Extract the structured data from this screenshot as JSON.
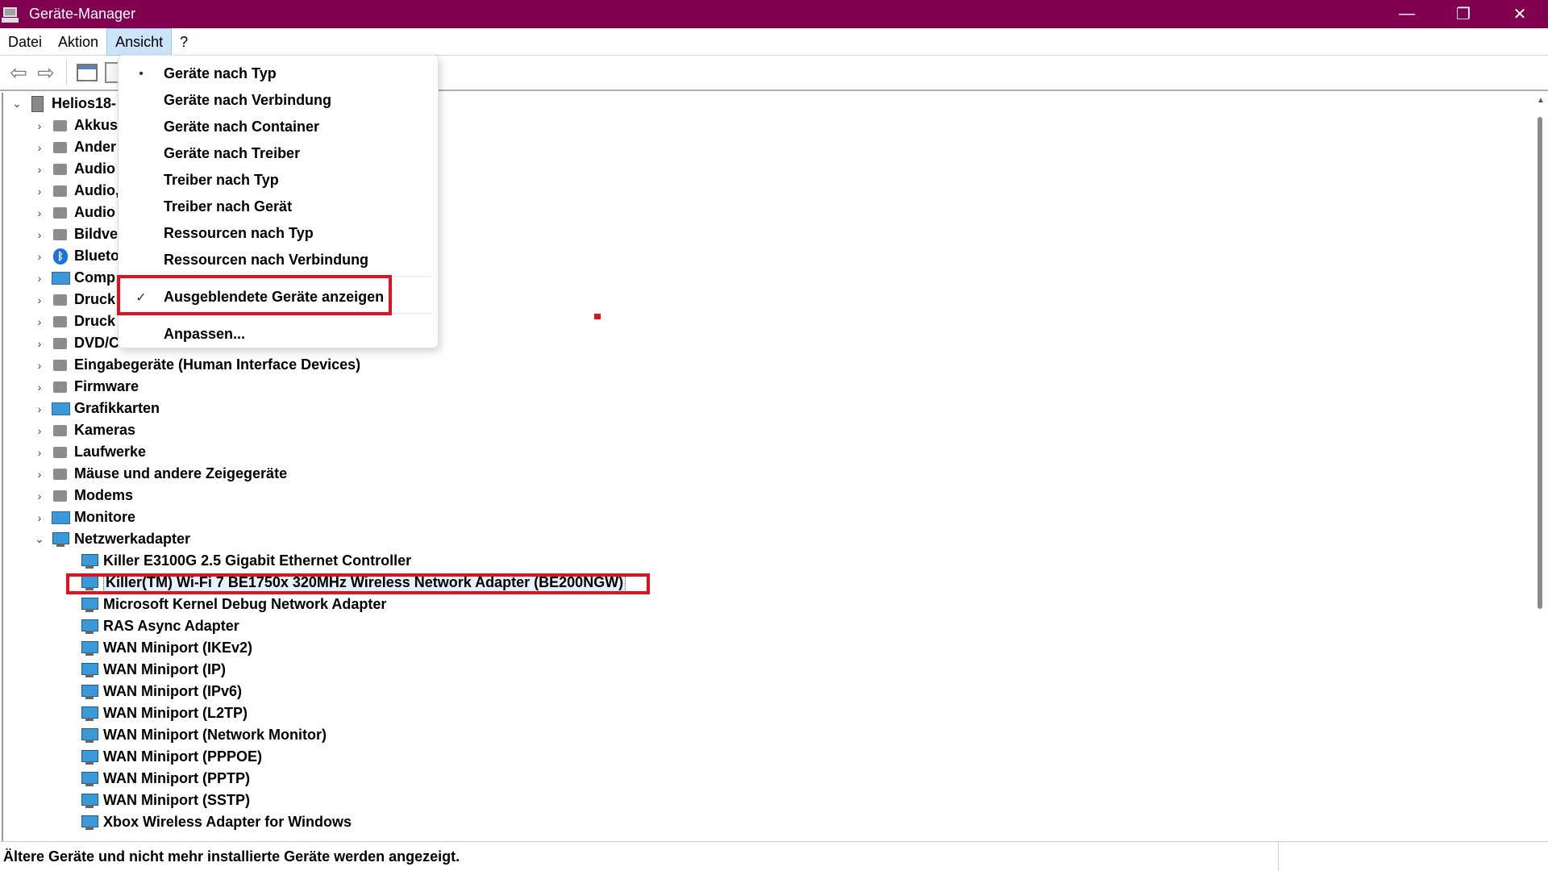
{
  "window": {
    "title": "Geräte-Manager",
    "controls": {
      "minimize": "—",
      "restore": "❐",
      "close": "✕"
    }
  },
  "menubar": {
    "items": [
      {
        "label": "Datei"
      },
      {
        "label": "Aktion"
      },
      {
        "label": "Ansicht",
        "open": true
      },
      {
        "label": "?"
      }
    ]
  },
  "toolbar": {
    "back_icon": "back-arrow-icon",
    "forward_icon": "forward-arrow-icon"
  },
  "tree": {
    "root": {
      "label": "Helios18-"
    },
    "categories": [
      {
        "label": "Akkus",
        "icon": "battery-icon"
      },
      {
        "label": "Ander",
        "icon": "unknown-device-icon"
      },
      {
        "label": "Audio",
        "icon": "audio-icon"
      },
      {
        "label": "Audio,",
        "icon": "audio-icon"
      },
      {
        "label": "Audio",
        "icon": "audio-icon"
      },
      {
        "label": "Bildve",
        "icon": "camera-device-icon"
      },
      {
        "label": "Blueto",
        "icon": "bluetooth-icon"
      },
      {
        "label": "Comp",
        "icon": "computer-icon"
      },
      {
        "label": "Druck",
        "icon": "printer-icon"
      },
      {
        "label": "Druck",
        "icon": "printer-icon"
      },
      {
        "label": "DVD/C",
        "icon": "dvd-icon"
      },
      {
        "label": "Eingabegeräte (Human Interface Devices)",
        "icon": "hid-icon"
      },
      {
        "label": "Firmware",
        "icon": "firmware-icon"
      },
      {
        "label": "Grafikkarten",
        "icon": "display-adapter-icon"
      },
      {
        "label": "Kameras",
        "icon": "camera-icon"
      },
      {
        "label": "Laufwerke",
        "icon": "drive-icon"
      },
      {
        "label": "Mäuse und andere Zeigegeräte",
        "icon": "mouse-icon"
      },
      {
        "label": "Modems",
        "icon": "modem-icon"
      },
      {
        "label": "Monitore",
        "icon": "monitor-icon"
      }
    ],
    "network": {
      "label": "Netzwerkadapter",
      "children": [
        "Killer E3100G 2.5 Gigabit Ethernet Controller",
        "Killer(TM) Wi-Fi 7 BE1750x 320MHz Wireless Network Adapter (BE200NGW)",
        "Microsoft Kernel Debug Network Adapter",
        "RAS Async Adapter",
        "WAN Miniport (IKEv2)",
        "WAN Miniport (IP)",
        "WAN Miniport (IPv6)",
        "WAN Miniport (L2TP)",
        "WAN Miniport (Network Monitor)",
        "WAN Miniport (PPPOE)",
        "WAN Miniport (PPTP)",
        "WAN Miniport (SSTP)",
        "Xbox Wireless Adapter for Windows"
      ],
      "selected_index": 1
    }
  },
  "view_menu": {
    "items": [
      {
        "label": "Geräte nach Typ",
        "mark": "•"
      },
      {
        "label": "Geräte nach Verbindung",
        "mark": ""
      },
      {
        "label": "Geräte nach Container",
        "mark": ""
      },
      {
        "label": "Geräte nach Treiber",
        "mark": ""
      },
      {
        "label": "Treiber nach Typ",
        "mark": ""
      },
      {
        "label": "Treiber nach Gerät",
        "mark": ""
      },
      {
        "label": "Ressourcen nach Typ",
        "mark": ""
      },
      {
        "label": "Ressourcen nach Verbindung",
        "mark": ""
      }
    ],
    "show_hidden": {
      "label": "Ausgeblendete Geräte anzeigen",
      "mark": "✓",
      "checked": true
    },
    "customize": {
      "label": "Anpassen..."
    }
  },
  "statusbar": {
    "text": "Ältere Geräte und nicht mehr installierte Geräte werden angezeigt."
  },
  "colors": {
    "titlebar": "#820050",
    "annotation": "#e0121f",
    "menu_open": "#cce4f7"
  }
}
